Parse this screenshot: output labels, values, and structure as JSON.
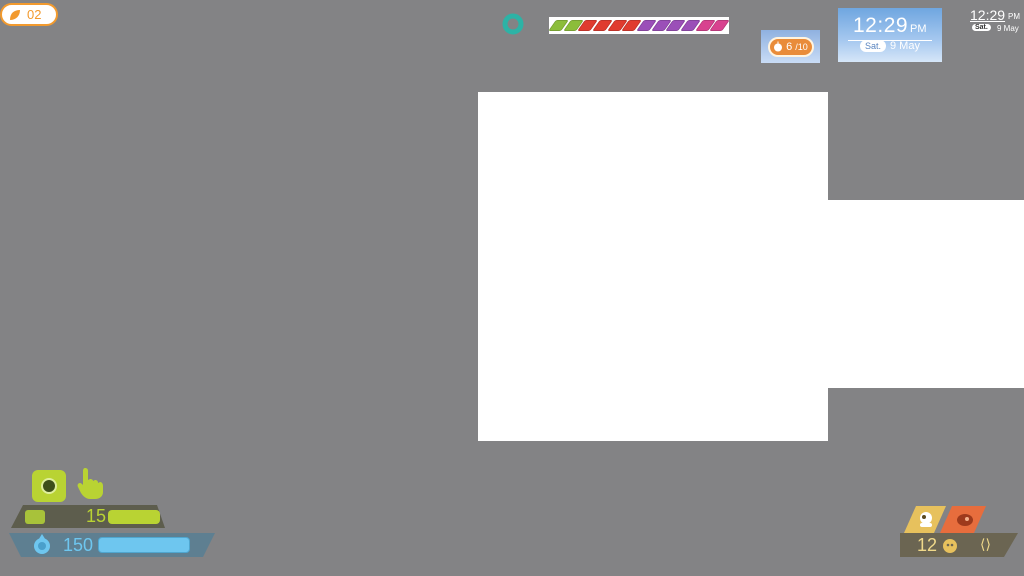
{
  "top_counter": {
    "value": "02",
    "icon": "leaf-icon"
  },
  "segment_bar": {
    "segments": [
      "#8cbd3a",
      "#8cbd3a",
      "#e03b2f",
      "#e03b2f",
      "#e03b2f",
      "#e03b2f",
      "#9b4fb8",
      "#9b4fb8",
      "#9b4fb8",
      "#9b4fb8",
      "#d8428f",
      "#d8428f"
    ]
  },
  "apple_counter": {
    "current": "6",
    "max": "/10"
  },
  "clock": {
    "time": "12:29",
    "ampm": "PM",
    "day": "Sat.",
    "date": "9 May"
  },
  "mini_clock": {
    "time": "12:29",
    "ampm": "PM",
    "day": "Sat.",
    "date": "9 May"
  },
  "hud_left": {
    "green_value": "15",
    "blue_value": "150"
  },
  "hud_right": {
    "gold_value": "12",
    "extra_symbol": "⟨⟩"
  },
  "colors": {
    "background": "#838385",
    "accent_orange": "#f29a2e",
    "green": "#b9d333",
    "blue": "#6ec6ef",
    "gold": "#e7c15d",
    "ring": "#2db3a6"
  }
}
